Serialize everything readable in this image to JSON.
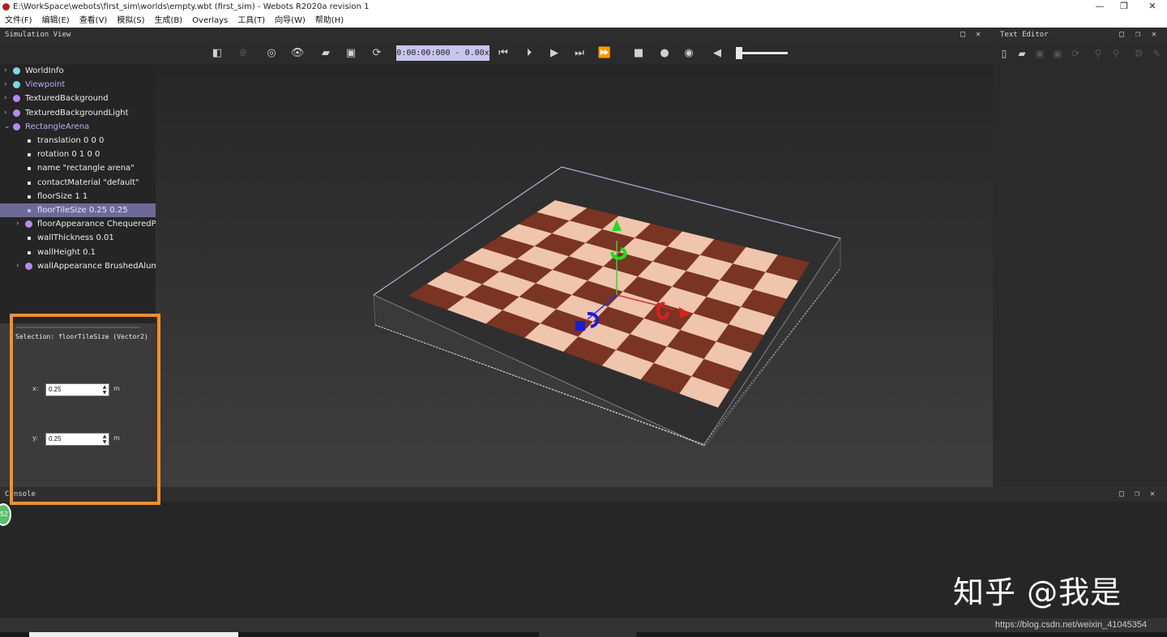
{
  "window": {
    "title": "E:\\WorkSpace\\webots\\first_sim\\worlds\\empty.wbt (first_sim) - Webots R2020a revision 1",
    "minimize": "—",
    "maximize": "❐",
    "close": "✕"
  },
  "menu": [
    "文件(F)",
    "编辑(E)",
    "查看(V)",
    "模拟(S)",
    "生成(B)",
    "Overlays",
    "工具(T)",
    "向导(W)",
    "帮助(H)"
  ],
  "simulation_view": {
    "title": "Simulation View",
    "float": "□",
    "close": "✕"
  },
  "text_editor": {
    "title": "Text Editor",
    "float": "□",
    "restore": "❐",
    "close": "✕"
  },
  "toolbar": {
    "clock": "0:00:00:000 - 0.00x"
  },
  "scene_tree": [
    {
      "label": "WorldInfo",
      "level": 0,
      "kind": "node",
      "expander": "›",
      "color": "#7fd6e6"
    },
    {
      "label": "Viewpoint",
      "level": 0,
      "kind": "node",
      "expander": "›",
      "color": "#7fd6e6"
    },
    {
      "label": "TexturedBackground",
      "level": 0,
      "kind": "node",
      "expander": "›",
      "color": "#b58be8"
    },
    {
      "label": "TexturedBackgroundLight",
      "level": 0,
      "kind": "node",
      "expander": "›",
      "color": "#b58be8"
    },
    {
      "label": "RectangleArena",
      "level": 0,
      "kind": "node",
      "expander": "⌄",
      "color": "#b58be8"
    },
    {
      "label": "translation 0 0 0",
      "level": 1,
      "kind": "field",
      "expander": ""
    },
    {
      "label": "rotation 0 1 0 0",
      "level": 1,
      "kind": "field",
      "expander": ""
    },
    {
      "label": "name \"rectangle arena\"",
      "level": 1,
      "kind": "field",
      "expander": ""
    },
    {
      "label": "contactMaterial \"default\"",
      "level": 1,
      "kind": "field",
      "expander": ""
    },
    {
      "label": "floorSize 1 1",
      "level": 1,
      "kind": "field",
      "expander": ""
    },
    {
      "label": "floorTileSize 0.25 0.25",
      "level": 1,
      "kind": "field",
      "expander": ""
    },
    {
      "label": "floorAppearance ChequeredParquetry",
      "level": 1,
      "kind": "node",
      "expander": "›",
      "color": "#b58be8"
    },
    {
      "label": "wallThickness 0.01",
      "level": 1,
      "kind": "field",
      "expander": ""
    },
    {
      "label": "wallHeight 0.1",
      "level": 1,
      "kind": "field",
      "expander": ""
    },
    {
      "label": "wallAppearance BrushedAluminium",
      "level": 1,
      "kind": "node",
      "expander": "›",
      "color": "#b58be8"
    }
  ],
  "field_editor": {
    "selection": "Selection: floorTileSize (Vector2)",
    "x_label": "x:",
    "x_value": "0.25",
    "y_label": "y:",
    "y_value": "0.25",
    "unit": "m"
  },
  "console": {
    "title": "Console",
    "badge": "52",
    "float": "□",
    "restore": "❐",
    "close": "✕"
  },
  "watermark": {
    "text": "知乎 @我是",
    "url": "https://blog.csdn.net/weixin_41045354"
  },
  "colors": {
    "selected_row": "#6e6a98",
    "highlight_box": "#f28f2d",
    "clock_bg": "#c9c4ee",
    "tile_dark": "#7a3422",
    "tile_light": "#f0c5ad"
  }
}
